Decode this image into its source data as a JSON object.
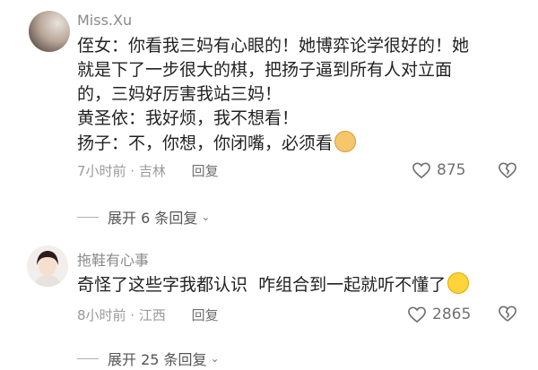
{
  "comments": [
    {
      "username": "Miss.Xu",
      "lines": [
        "侄女：你看我三妈有心眼的！她博弈论学很好的！她",
        "就是下了一步很大的棋，把扬子逼到所有人对立面",
        "的，三妈好厉害我站三妈！",
        "黄圣依：我好烦，我不想看！",
        "扬子：不，你想，你闭嘴，必须看"
      ],
      "emoji": "dog-face-icon",
      "meta": "7小时前 · 吉林",
      "reply_label": "回复",
      "likes": "875",
      "expand_label": "展开 6 条回复"
    },
    {
      "username": "拖鞋有心事",
      "lines": [
        "奇怪了这些字我都认识  咋组合到一起就听不懂了"
      ],
      "emoji": "laughing-tears-icon",
      "meta": "8小时前 · 江西",
      "reply_label": "回复",
      "likes": "2865",
      "expand_label": "展开 25 条回复"
    }
  ],
  "colors": {
    "meta": "#9a9a9a",
    "text": "#222222",
    "accent_muted": "#707070"
  }
}
